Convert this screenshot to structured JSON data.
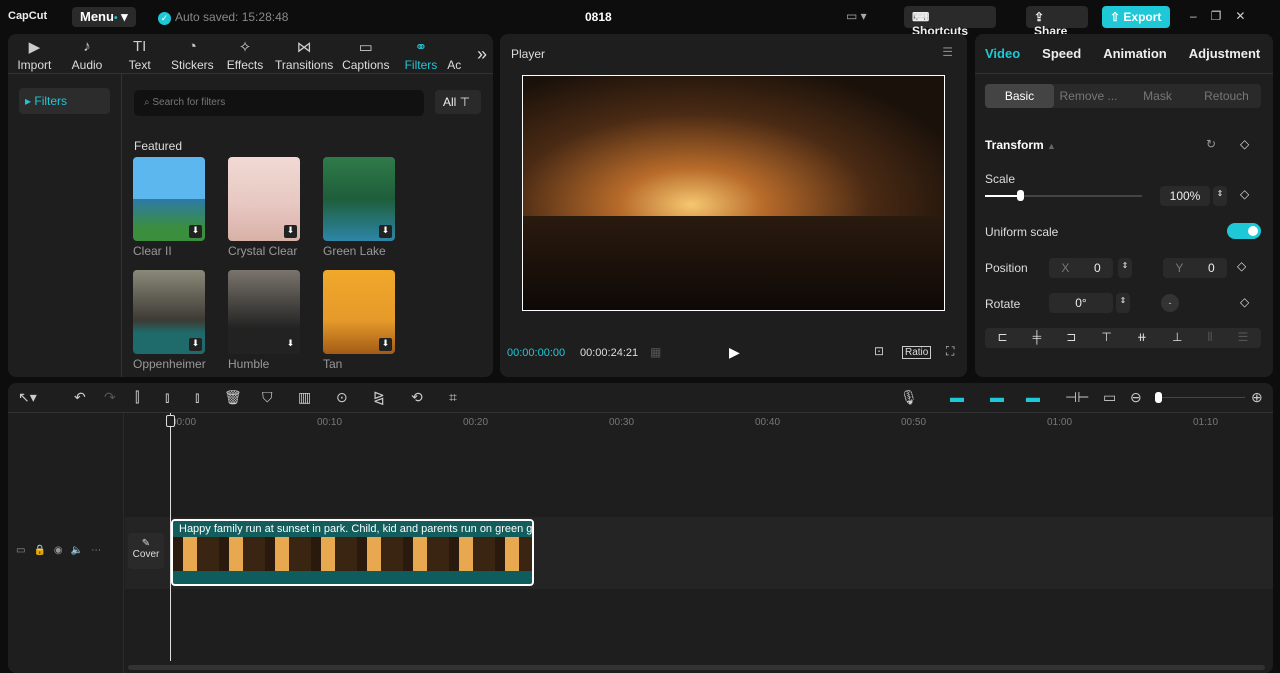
{
  "top": {
    "logo": "CapCut",
    "menu": "Menu",
    "autosaved": "Auto saved: 15:28:48",
    "title": "0818",
    "shortcuts": "Shortcuts",
    "share": "Share",
    "export": "Export"
  },
  "tabs": [
    {
      "label": "Import",
      "icon": "▶"
    },
    {
      "label": "Audio",
      "icon": "♪"
    },
    {
      "label": "Text",
      "icon": "TI"
    },
    {
      "label": "Stickers",
      "icon": "◔"
    },
    {
      "label": "Effects",
      "icon": "✧"
    },
    {
      "label": "Transitions",
      "icon": "⋈"
    },
    {
      "label": "Captions",
      "icon": "▭"
    },
    {
      "label": "Filters",
      "icon": "⚭"
    },
    {
      "label": "Ac",
      "icon": ""
    }
  ],
  "sidebar": {
    "item": "Filters"
  },
  "search": {
    "placeholder": "Search for filters",
    "all": "All"
  },
  "featured": "Featured",
  "filters": [
    {
      "name": "Clear II",
      "color": "#3a8ec9"
    },
    {
      "name": "Crystal Clear",
      "color": "#e6c6c0"
    },
    {
      "name": "Green Lake",
      "color": "#2f7a4a"
    },
    {
      "name": "Oppenheimer",
      "color": "#4c5a55"
    },
    {
      "name": "Humble",
      "color": "#3a3535"
    },
    {
      "name": "Tan",
      "color": "#e59a2a"
    }
  ],
  "player": {
    "title": "Player",
    "current": "00:00:00:00",
    "total": "00:00:24:21",
    "ratio": "Ratio"
  },
  "right": {
    "tabs": [
      "Video",
      "Speed",
      "Animation",
      "Adjustment"
    ],
    "sub": [
      "Basic",
      "Remove ...",
      "Mask",
      "Retouch"
    ],
    "transform": "Transform",
    "scale": "Scale",
    "scale_value": "100%",
    "scale_fraction": 0.22,
    "uniform": "Uniform scale",
    "uniform_on": true,
    "position": "Position",
    "x_label": "X",
    "x": "0",
    "y_label": "Y",
    "y": "0",
    "rotate": "Rotate",
    "rotate_value": "0°"
  },
  "timeline": {
    "ticks": [
      "00:00",
      "00:10",
      "00:20",
      "00:30",
      "00:40",
      "00:50",
      "01:00",
      "01:10"
    ],
    "cover": "Cover",
    "clip_title": "Happy family run at sunset in park. Child, kid and parents run on green grass"
  }
}
